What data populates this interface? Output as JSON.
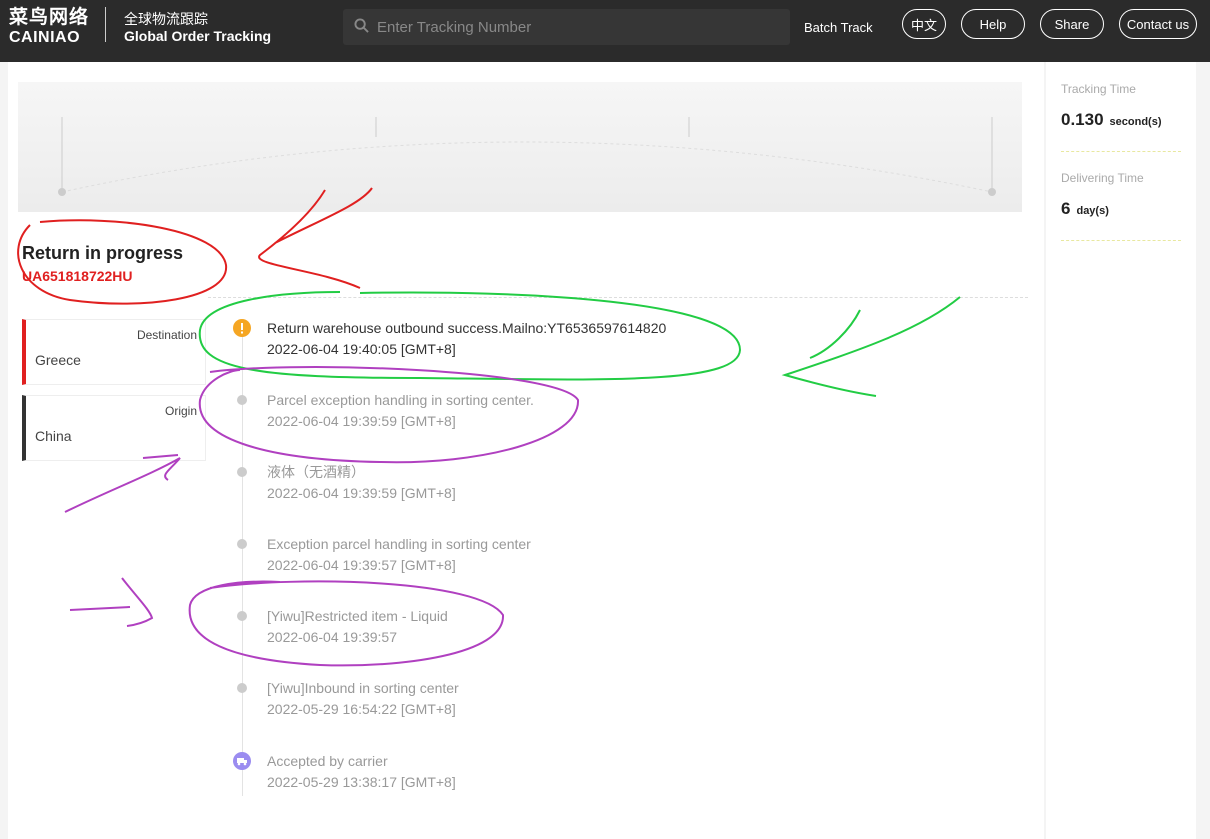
{
  "header": {
    "logo_cn": "菜鸟网络",
    "logo_en": "CAINIAO",
    "title_cn": "全球物流跟踪",
    "title_en": "Global Order Tracking",
    "search_placeholder": "Enter Tracking Number",
    "batch_track": "Batch Track",
    "buttons": [
      "中文",
      "Help",
      "Share",
      "Contact us"
    ]
  },
  "parcel": {
    "status": "Return in progress",
    "tracking_number": "UA651818722HU",
    "destination_label": "Destination",
    "destination": "Greece",
    "origin_label": "Origin",
    "origin": "China"
  },
  "events": [
    {
      "desc": "Return warehouse outbound success.Mailno:YT6536597614820",
      "time": "2022-06-04 19:40:05 [GMT+8]"
    },
    {
      "desc": "Parcel exception handling in sorting center.",
      "time": "2022-06-04 19:39:59 [GMT+8]"
    },
    {
      "desc": "液体（无酒精）",
      "time": "2022-06-04 19:39:59 [GMT+8]"
    },
    {
      "desc": "Exception parcel handling in sorting center",
      "time": "2022-06-04 19:39:57 [GMT+8]"
    },
    {
      "desc": "[Yiwu]Restricted item - Liquid",
      "time": "2022-06-04 19:39:57"
    },
    {
      "desc": "[Yiwu]Inbound in sorting center",
      "time": "2022-05-29 16:54:22 [GMT+8]"
    },
    {
      "desc": "Accepted by carrier",
      "time": "2022-05-29 13:38:17 [GMT+8]"
    }
  ],
  "sidebar": {
    "tracking_time_label": "Tracking Time",
    "tracking_time": "0.130",
    "tracking_unit": "second(s)",
    "delivering_time_label": "Delivering Time",
    "delivering_time": "6",
    "delivering_unit": "day(s)"
  },
  "colors": {
    "header": "#2b2b2b",
    "accent_red": "#e02020",
    "warning": "#f5a623",
    "carrier": "#9b8cf0"
  }
}
